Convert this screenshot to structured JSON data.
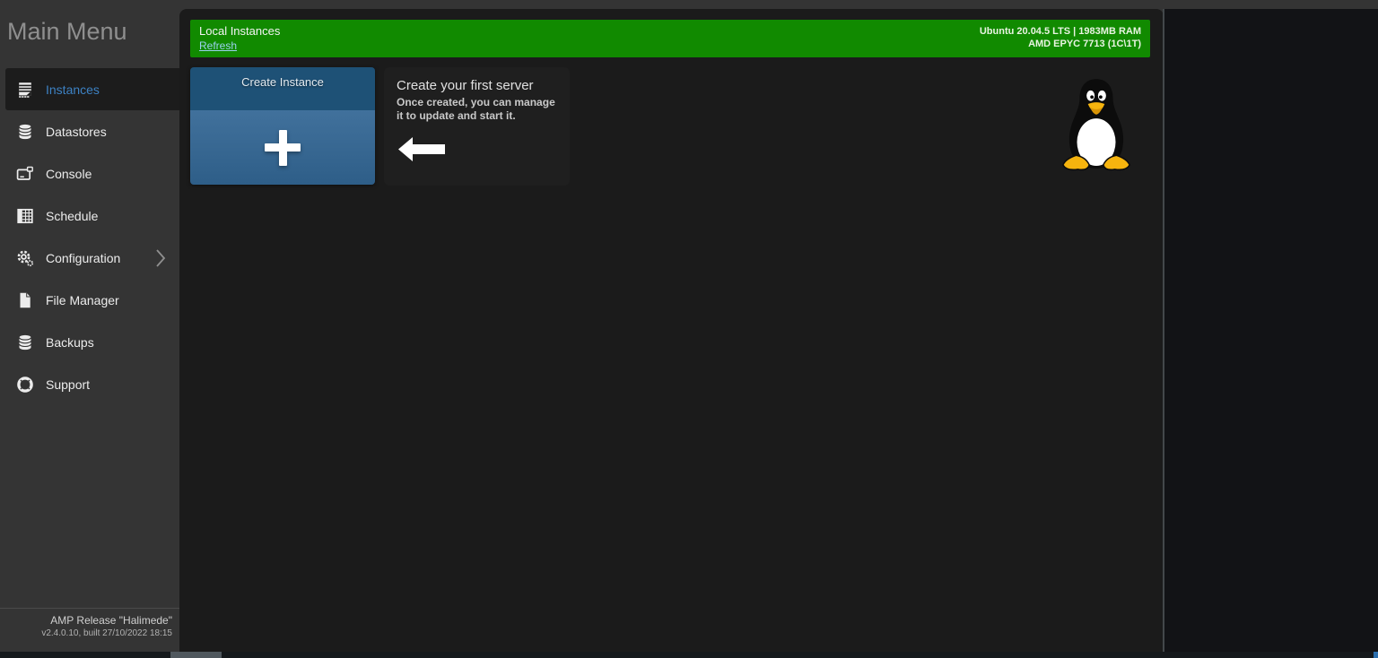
{
  "app": {
    "menu_title": "Main Menu",
    "release_line1": "AMP Release \"Halimede\"",
    "release_line2": "v2.4.0.10, built 27/10/2022 18:15"
  },
  "sidebar": {
    "items": [
      {
        "label": "Instances",
        "icon": "instances-icon",
        "active": true
      },
      {
        "label": "Datastores",
        "icon": "datastores-icon",
        "active": false
      },
      {
        "label": "Console",
        "icon": "console-icon",
        "active": false
      },
      {
        "label": "Schedule",
        "icon": "schedule-icon",
        "active": false
      },
      {
        "label": "Configuration",
        "icon": "configuration-icon",
        "active": false,
        "has_chevron": true
      },
      {
        "label": "File Manager",
        "icon": "file-manager-icon",
        "active": false
      },
      {
        "label": "Backups",
        "icon": "backups-icon",
        "active": false
      },
      {
        "label": "Support",
        "icon": "support-icon",
        "active": false
      }
    ]
  },
  "header": {
    "title": "Local Instances",
    "refresh_label": "Refresh",
    "system_line1": "Ubuntu 20.04.5 LTS | 1983MB RAM",
    "system_line2": "AMD EPYC 7713 (1C\\1T)"
  },
  "main": {
    "create_card": {
      "title": "Create Instance"
    },
    "hint_card": {
      "title": "Create your first server",
      "body": "Once created, you can manage it to update and start it."
    }
  },
  "colors": {
    "accent_green": "#118a00",
    "accent_blue_active": "#3d82c4",
    "refresh_link": "#9bd1ee",
    "card_header_blue": "#1e5176",
    "card_body_blue_top": "#41719c",
    "card_body_blue_bottom": "#2e5e88",
    "sidebar_bg": "#343434",
    "panel_bg": "#1b1b1b",
    "tux_yellow": "#f6b40e"
  }
}
